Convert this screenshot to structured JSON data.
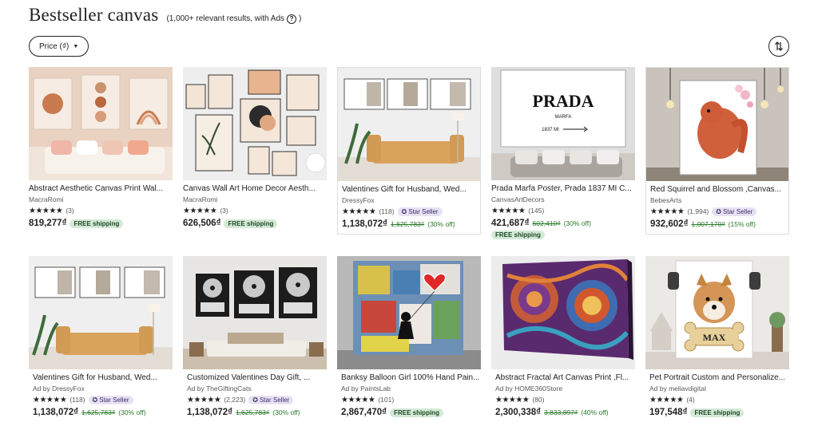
{
  "header": {
    "title": "Bestseller canvas",
    "subtitle": "(1,000+ relevant results, with Ads",
    "help_icon": "?"
  },
  "filters": {
    "price_label": "Price (₫)",
    "sort_icon": "sort-icon"
  },
  "products": [
    {
      "title": "Abstract Aesthetic Canvas Print Wal...",
      "shop": "MacraRomi",
      "stars": "★★★★★",
      "count": "(3)",
      "badge": "",
      "price": "819,277₫",
      "orig": "",
      "disc": "",
      "free": "FREE shipping"
    },
    {
      "title": "Canvas Wall Art Home Decor Aesth...",
      "shop": "MacraRomi",
      "stars": "★★★★★",
      "count": "(3)",
      "badge": "",
      "price": "626,506₫",
      "free": "FREE shipping"
    },
    {
      "title": "Valentines Gift for Husband, Wed...",
      "shop": "DressyFox",
      "stars": "★★★★★",
      "count": "(118)",
      "badge": "Star Seller",
      "price": "1,138,072₫",
      "orig": "1,625,783₫",
      "disc": "(30% off)"
    },
    {
      "title": "Prada Marfa Poster, Prada 1837 MI C...",
      "shop": "CanvasArtDecors",
      "stars": "★★★★★",
      "count": "(145)",
      "badge": "",
      "price": "421,687₫",
      "orig": "602,410₫",
      "disc": "(30% off)",
      "free": "FREE shipping"
    },
    {
      "title": "Red Squirrel and Blossom ,Canvas...",
      "shop": "BebesArts",
      "stars": "★★★★★",
      "count": "(1,994)",
      "badge": "Star Seller",
      "price": "932,602₫",
      "orig": "1,007,170₫",
      "disc": "(15% off)"
    },
    {
      "title": "Valentines Gift for Husband, Wed...",
      "shop": "Ad by DressyFox",
      "stars": "★★★★★",
      "count": "(118)",
      "badge": "Star Seller",
      "price": "1,138,072₫",
      "orig": "1,625,783₫",
      "disc": "(30% off)"
    },
    {
      "title": "Customized Valentines Day Gift, ...",
      "shop": "Ad by TheGiftingCats",
      "stars": "★★★★★",
      "count": "(2,223)",
      "badge": "Star Seller",
      "price": "1,138,072₫",
      "orig": "1,625,783₫",
      "disc": "(30% off)"
    },
    {
      "title": "Banksy Balloon Girl 100% Hand Pain...",
      "shop": "Ad by PaintsLab",
      "stars": "★★★★★",
      "count": "(101)",
      "badge": "",
      "price": "2,867,470₫",
      "free": "FREE shipping"
    },
    {
      "title": "Abstract Fractal Art Canvas Print ,Fl...",
      "shop": "Ad by HOME360Store",
      "stars": "★★★★★",
      "count": "(80)",
      "badge": "",
      "price": "2,300,338₫",
      "orig": "3,833,897₫",
      "disc": "(40% off)"
    },
    {
      "title": "Pet Portrait Custom and Personalize...",
      "shop": "Ad by meliavdigital",
      "stars": "★★★★★",
      "count": "(4)",
      "badge": "",
      "price": "197,548₫",
      "free": "FREE shipping"
    }
  ],
  "image_text": {
    "prada_brand": "PRADA",
    "prada_sub": "MARFA",
    "prada_year": "1837 MI",
    "pet_name": "MAX"
  },
  "colors": {
    "star_badge_bg": "#e6e2f3",
    "free_ship_bg": "#d4e9d7",
    "discount": "#2a7a2a"
  }
}
